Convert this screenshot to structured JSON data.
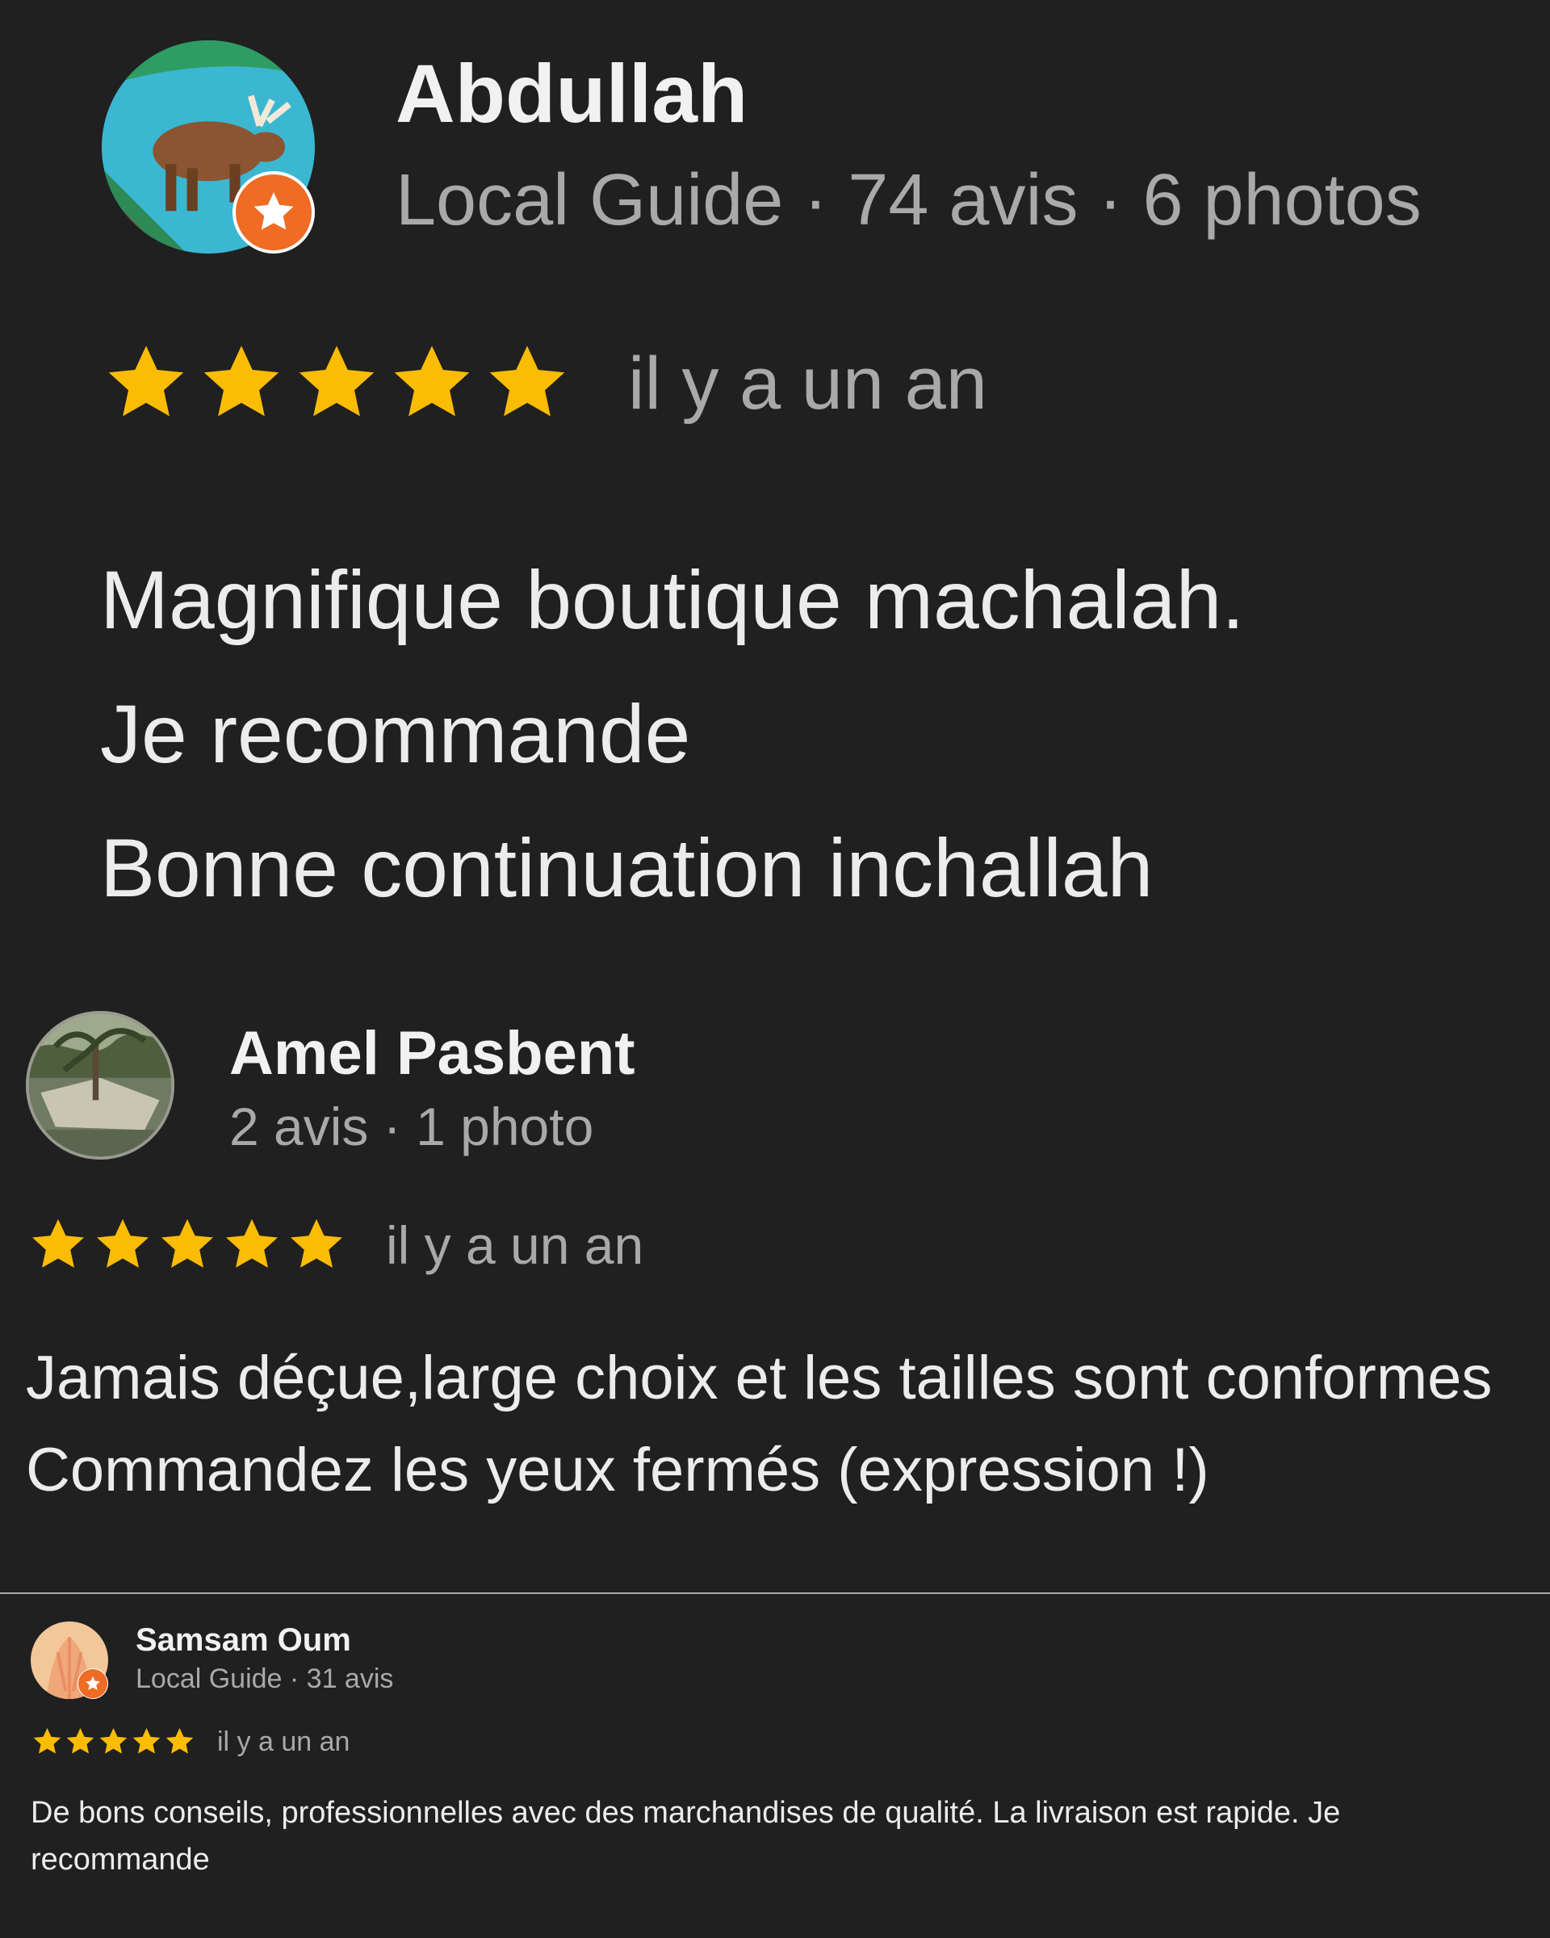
{
  "colors": {
    "background": "#202020",
    "star": "#fbbc04",
    "badge": "#f06b23",
    "meta_text": "#a9a9a9",
    "main_text": "#ececec"
  },
  "reviews": [
    {
      "name": "Abdullah",
      "meta": "Local Guide · 74 avis · 6 photos",
      "local_guide": true,
      "avatar_icon": "moose-avatar",
      "rating": 5,
      "time": "il y a un an",
      "text": "Magnifique boutique machalah.\nJe recommande\nBonne continuation inchallah"
    },
    {
      "name": "Amel Pasbent",
      "meta": "2 avis · 1 photo",
      "local_guide": false,
      "avatar_icon": "palm-photo-avatar",
      "rating": 5,
      "time": "il y a un an",
      "text": "Jamais déçue,large choix et les tailles sont conformes\nCommandez les yeux fermés (expression !)"
    },
    {
      "name": "Samsam Oum",
      "meta": "Local Guide · 31 avis",
      "local_guide": true,
      "avatar_icon": "peach-avatar",
      "rating": 5,
      "time": "il y a un an",
      "text": "De bons conseils, professionnelles avec des marchandises de qualité. La livraison est rapide. Je\nrecommande"
    }
  ]
}
